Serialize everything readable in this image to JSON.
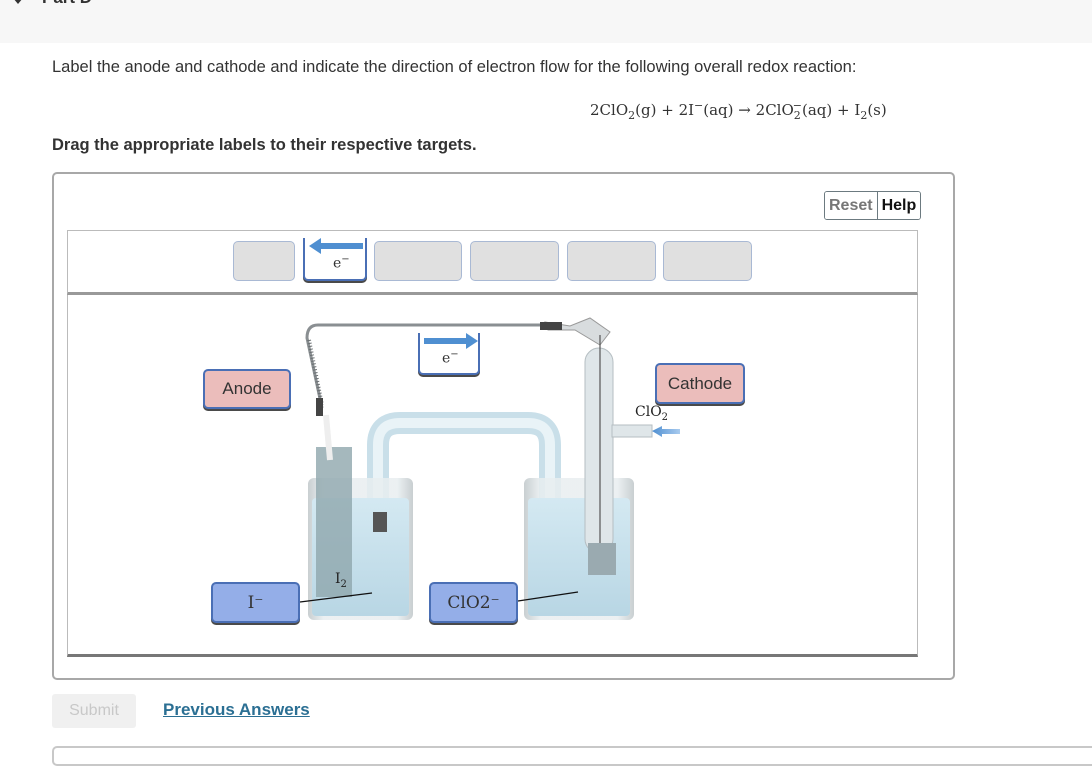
{
  "part": {
    "title": "Part D",
    "expanded": true
  },
  "question": {
    "prompt": "Label the anode and cathode and indicate the direction of electron flow for the following overall redox reaction:",
    "equation": {
      "reactant1": "2ClO",
      "reactant1_sub": "2",
      "reactant1_state": "(g)",
      "plus1": "+",
      "reactant2": "2I",
      "reactant2_sup": "−",
      "reactant2_state": "(aq)",
      "arrow": "→",
      "product1": "2ClO",
      "product1_sub": "2",
      "product1_sup": "−",
      "product1_state": "(aq)",
      "plus2": "+",
      "product2": "I",
      "product2_sub": "2",
      "product2_state": "(s)"
    },
    "instruction": "Drag the appropriate labels to their respective targets."
  },
  "toolbar": {
    "reset_label": "Reset",
    "help_label": "Help"
  },
  "label_tray": {
    "slots": [
      {
        "id": 1,
        "content": ""
      },
      {
        "id": 2,
        "content": "e-arrow-left"
      },
      {
        "id": 3,
        "content": ""
      },
      {
        "id": 4,
        "content": ""
      },
      {
        "id": 5,
        "content": ""
      },
      {
        "id": 6,
        "content": ""
      }
    ],
    "tray_arrow_label": "e",
    "tray_arrow_sup": "−",
    "tray_arrow_direction": "left"
  },
  "placed_labels": {
    "anode": "Anode",
    "cathode": "Cathode",
    "wire_arrow_label": "e",
    "wire_arrow_sup": "−",
    "wire_arrow_direction": "right",
    "left_solution": "I⁻",
    "right_solution": "ClO2⁻"
  },
  "diagram_annotations": {
    "gas_inlet": "ClO",
    "gas_inlet_sub": "2",
    "solid_product": "I",
    "solid_product_sub": "2"
  },
  "colors": {
    "pink_label": "#ebbdbb",
    "blue_label": "#94aee8",
    "label_border": "#4a6fb5",
    "arrow": "#4f8fd1",
    "link": "#2b6f93",
    "solution": "#c9e2ee"
  },
  "footer": {
    "submit_label": "Submit",
    "submit_enabled": false,
    "previous_answers_label": "Previous Answers"
  }
}
